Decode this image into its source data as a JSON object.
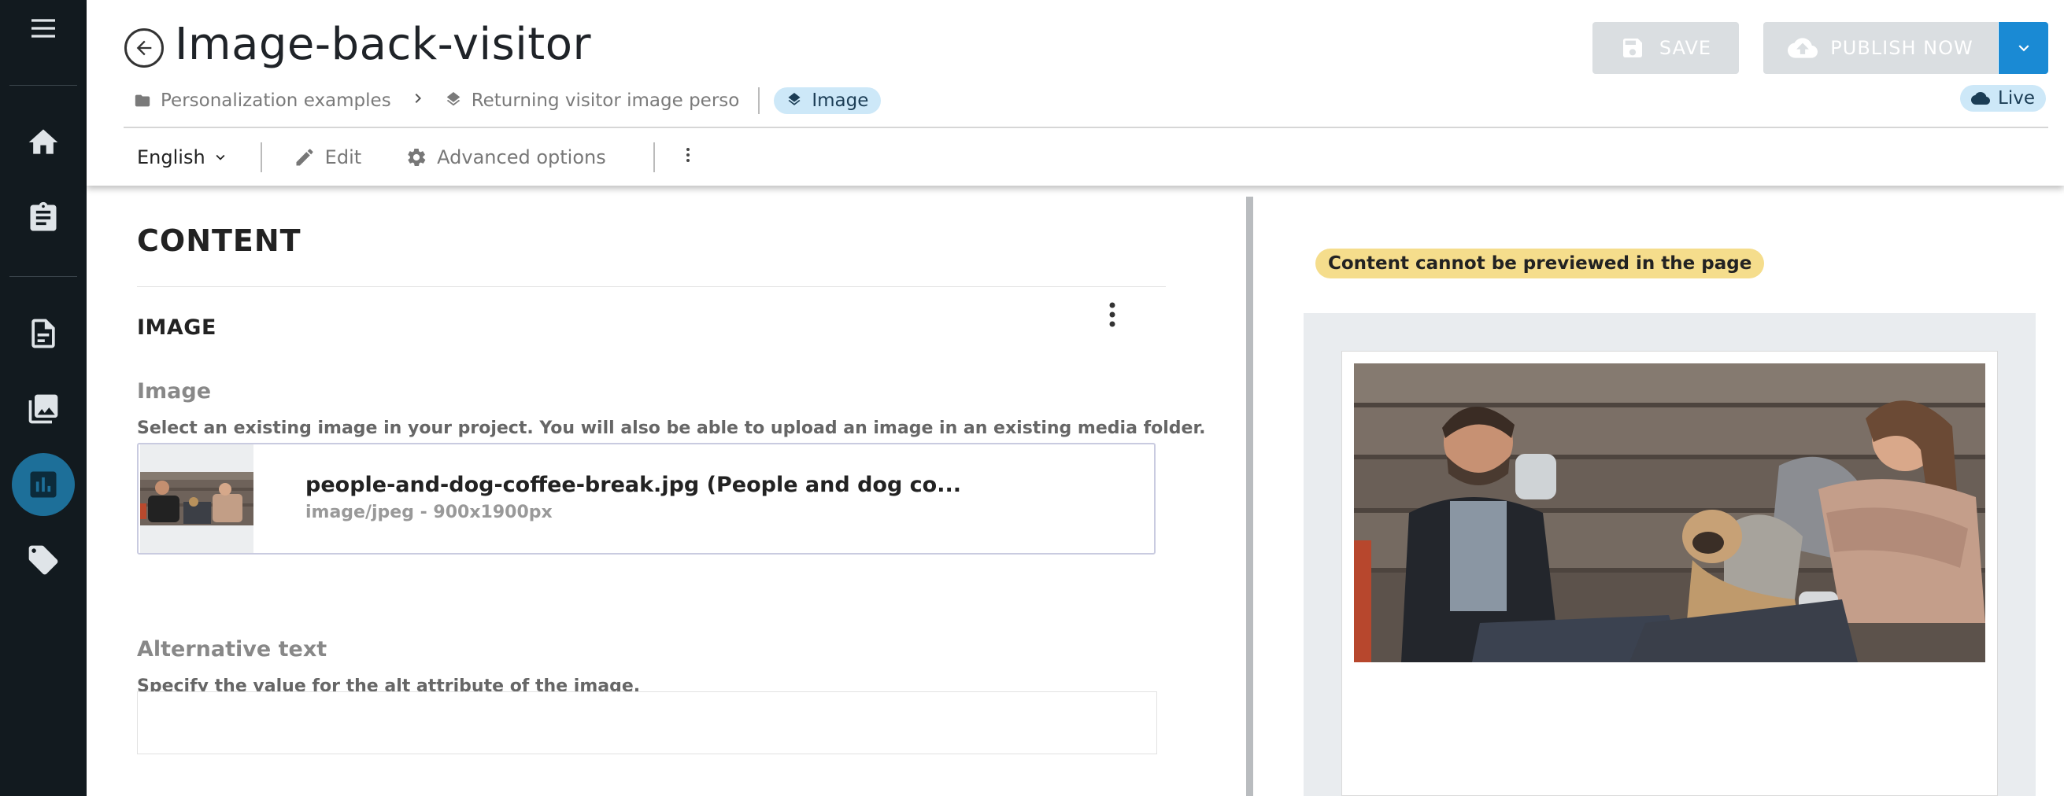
{
  "title": "Image-back-visitor",
  "breadcrumb": {
    "folder": "Personalization examples",
    "item": "Returning visitor image perso",
    "type_chip": "Image"
  },
  "actions": {
    "save": "SAVE",
    "publish": "PUBLISH NOW",
    "status": "Live"
  },
  "toolbar": {
    "language": "English",
    "edit": "Edit",
    "advanced": "Advanced options"
  },
  "content": {
    "heading": "CONTENT",
    "section": "IMAGE",
    "image_label": "Image",
    "image_help": "Select an existing image in your project. You will also be able to upload an image in an existing media folder.",
    "file_name": "people-and-dog-coffee-break.jpg (People and dog co...",
    "file_meta": "image/jpeg - 900x1900px",
    "alt_label": "Alternative text",
    "alt_help": "Specify the value for the alt attribute of the image.",
    "alt_value": ""
  },
  "preview": {
    "warning": "Content cannot be previewed in the page"
  },
  "sidebar": {
    "items": [
      "menu-icon",
      "home-icon",
      "clipboard-icon",
      "content-icon",
      "media-icon",
      "analytics-icon",
      "tag-icon"
    ],
    "active": "analytics-icon"
  },
  "colors": {
    "sidebar_bg": "#121a1f",
    "accent": "#1a8ad4",
    "active_item": "#1d6f99",
    "chip_bg": "#cde8f8",
    "warning_bg": "#f5dd8c",
    "disabled_btn": "#dadee1"
  }
}
